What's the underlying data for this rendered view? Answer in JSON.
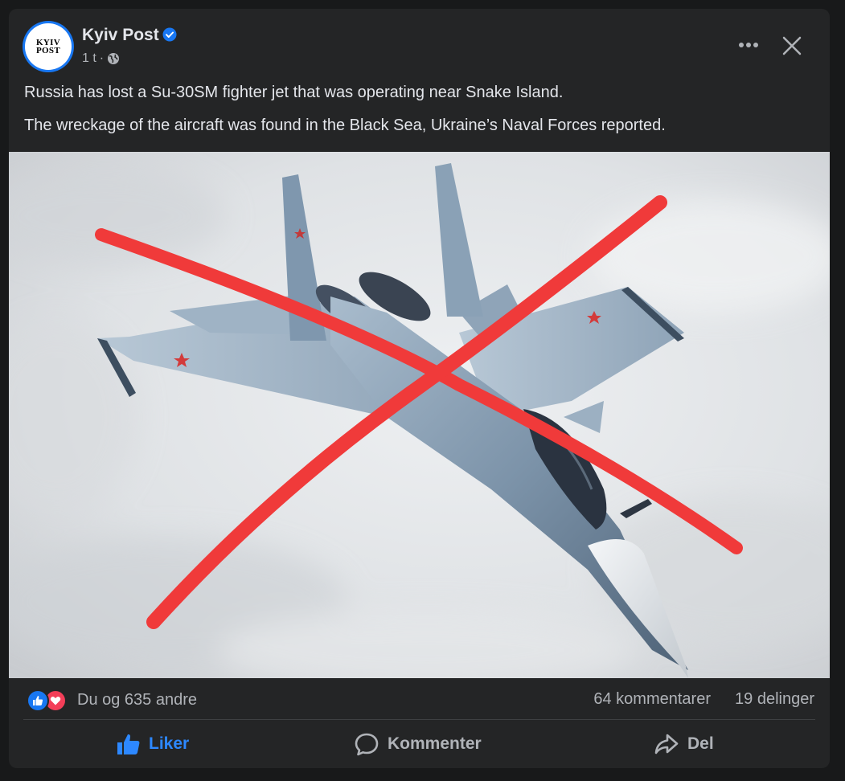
{
  "post": {
    "author": {
      "name": "Kyiv Post",
      "avatar_text_line1": "KYIV",
      "avatar_text_line2": "POST",
      "verified_icon": "verified-badge-icon"
    },
    "time": "1 t",
    "separator": "·",
    "audience_icon": "globe-icon",
    "menu_icon": "more-options-icon",
    "close_icon": "close-icon",
    "text_lines": [
      "Russia has lost a Su-30SM fighter jet that was operating near Snake Island.",
      "The wreckage of the aircraft was found in the Black Sea, Ukraine’s Naval Forces reported."
    ],
    "image": {
      "subject": "fighter-jet-photo",
      "overlay": "red-x-mark",
      "overlay_color": "#f03a3a"
    },
    "stats": {
      "reaction_icons": [
        "like-reaction-icon",
        "love-reaction-icon"
      ],
      "reactions_text": "Du og 635 andre",
      "comments": "64 kommentarer",
      "shares": "19 delinger"
    },
    "actions": {
      "like": "Liker",
      "comment": "Kommenter",
      "share": "Del"
    }
  },
  "colors": {
    "page_bg": "#18191a",
    "card_bg": "#242526",
    "primary_text": "#e4e6eb",
    "secondary_text": "#b0b3b8",
    "accent": "#2d88ff",
    "like_blue": "#1877f2",
    "love_red": "#f33e58"
  }
}
